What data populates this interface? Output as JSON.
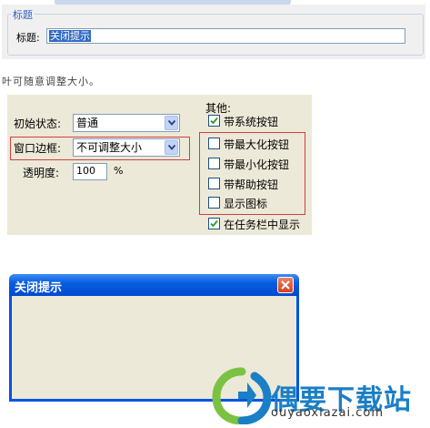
{
  "title_section": {
    "legend": "标题",
    "label": "标题:",
    "value": "关闭提示"
  },
  "partial_text": "叶可随意调整大小。",
  "form": {
    "initial_state": {
      "label": "初始状态:",
      "value": "普通"
    },
    "window_border": {
      "label": "窗口边框:",
      "value": "不可调整大小"
    },
    "opacity": {
      "label": "透明度:",
      "value": "100",
      "unit": "%"
    },
    "other": {
      "heading": "其他:",
      "options": [
        {
          "label": "带系统按钮",
          "checked": true
        },
        {
          "label": "带最大化按钮",
          "checked": false
        },
        {
          "label": "带最小化按钮",
          "checked": false
        },
        {
          "label": "带帮助按钮",
          "checked": false
        },
        {
          "label": "显示图标",
          "checked": false
        },
        {
          "label": "在任务栏中显示",
          "checked": true
        }
      ]
    }
  },
  "dialog": {
    "title": "关闭提示"
  },
  "watermark": {
    "name": "偶要下载站",
    "url": "ouyaoxiazai.com"
  },
  "colors": {
    "accent_red": "#d04040",
    "title_blue": "#0054e3",
    "panel_bg": "#ece9d8",
    "watermark_blue": "#1a7fc6"
  },
  "icons": [
    "chevron-down-icon",
    "checkmark-icon",
    "close-icon",
    "watermark-logo-icon"
  ]
}
